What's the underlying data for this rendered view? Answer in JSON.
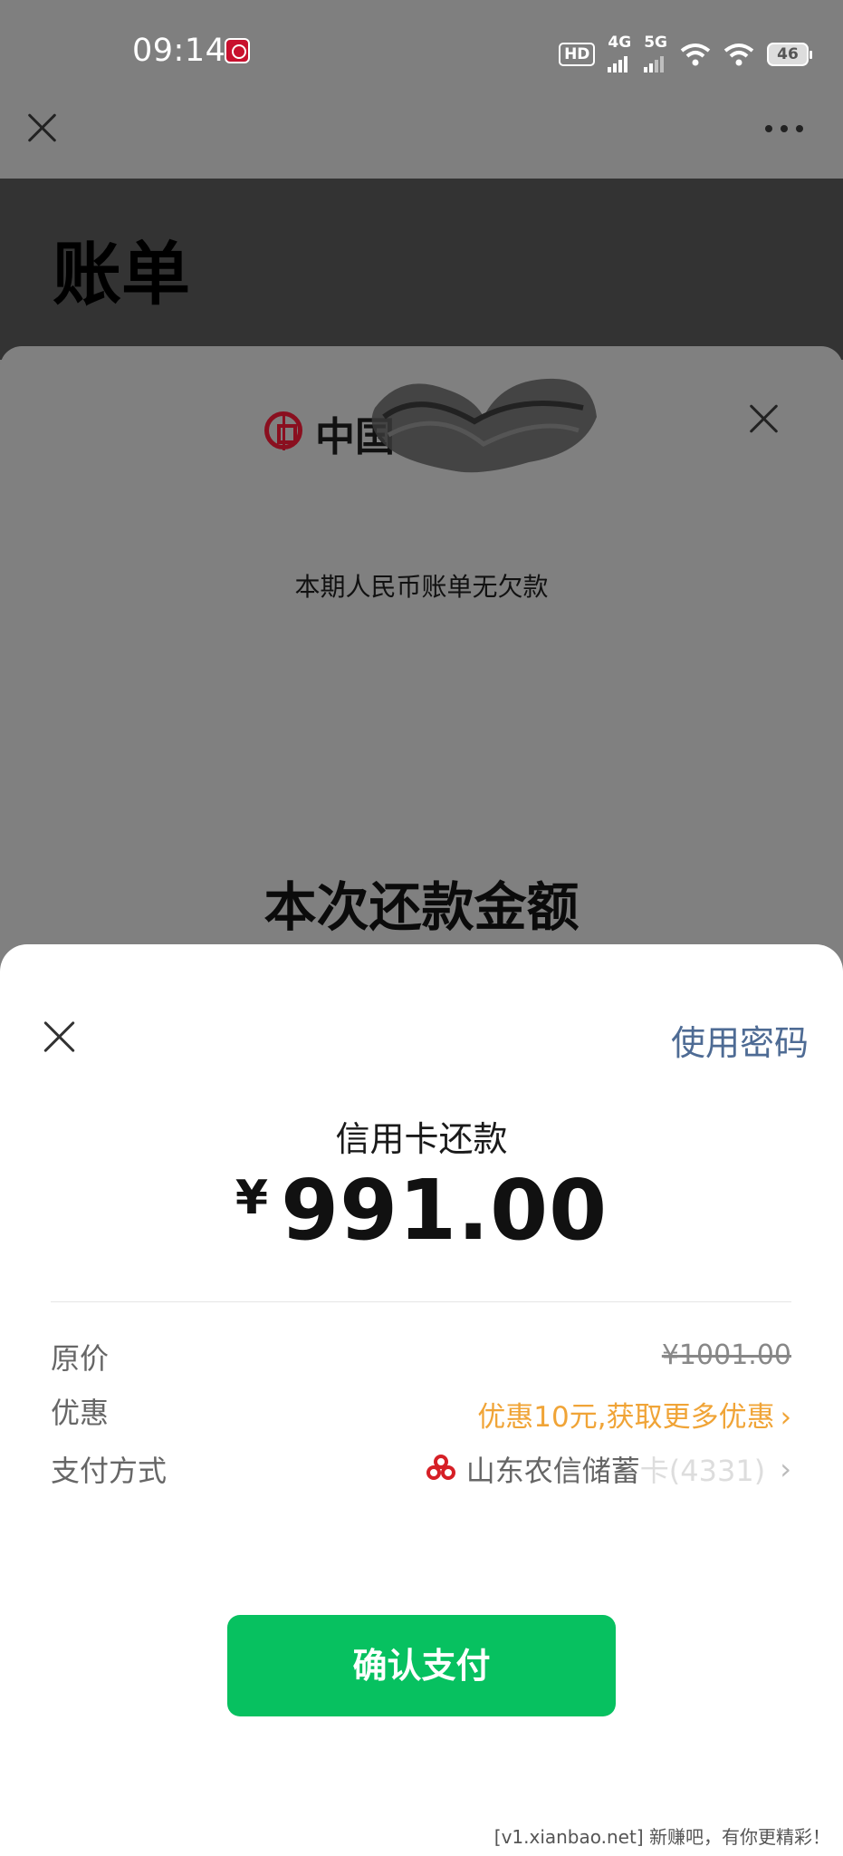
{
  "status_bar": {
    "time": "09:14",
    "hd": "HD",
    "net1": "4G",
    "net2": "5G",
    "battery": "46"
  },
  "bill_page": {
    "title": "账单",
    "bank_name": "中国",
    "no_debt_text": "本期人民币账单无欠款",
    "repay_title": "本次还款金额"
  },
  "pay_sheet": {
    "use_password": "使用密码",
    "description": "信用卡还款",
    "currency": "¥",
    "amount": "991.00",
    "original_price_label": "原价",
    "original_price": "¥1001.00",
    "discount_label": "优惠",
    "discount_text": "优惠10元,获取更多优惠",
    "method_label": "支付方式",
    "method_value": "山东农信储蓄",
    "method_masked": "卡(4331)",
    "confirm_button": "确认支付",
    "accent_color": "#07c160",
    "link_color": "#4e6b94",
    "discount_color": "#f0a437"
  },
  "watermark": "[v1.xianbao.net] 新赚吧，有你更精彩！"
}
